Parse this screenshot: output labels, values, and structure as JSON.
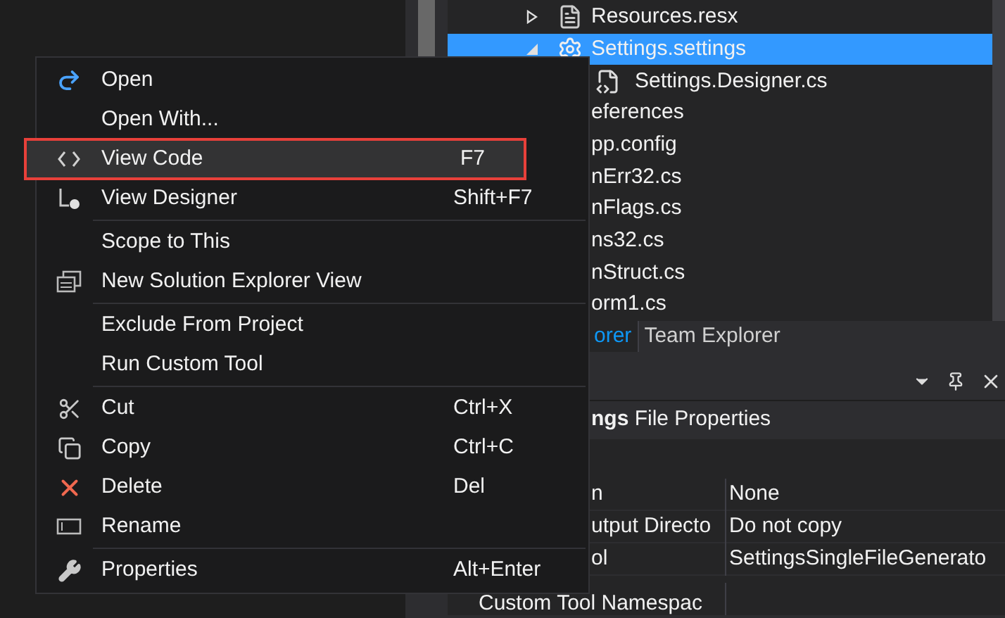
{
  "solution_explorer": {
    "tree": [
      {
        "label": "Resources.resx",
        "expanded": false,
        "selected": false
      },
      {
        "label": "Settings.settings",
        "expanded": true,
        "selected": true,
        "children": [
          {
            "label": "Settings.Designer.cs",
            "selected": false
          }
        ]
      }
    ],
    "covered_items": [
      {
        "label": "eferences"
      },
      {
        "label": "pp.config"
      },
      {
        "label": "nErr32.cs"
      },
      {
        "label": "nFlags.cs"
      },
      {
        "label": "ns32.cs"
      },
      {
        "label": "nStruct.cs"
      },
      {
        "label": "orm1.cs"
      }
    ]
  },
  "panel_tabs": [
    {
      "label": "orer",
      "selected": true
    },
    {
      "label": "Team Explorer",
      "selected": false
    }
  ],
  "properties": {
    "title": "**ngs** File Properties",
    "rows": [
      {
        "name": "n",
        "value": "None"
      },
      {
        "name": "utput Directo",
        "value": "Do not copy"
      },
      {
        "name": "ol",
        "value": "SettingsSingleFileGenerato"
      },
      {
        "name": "Custom Tool Namespac",
        "value": ""
      }
    ]
  },
  "context_menu": {
    "groups": [
      [
        {
          "label": "Open",
          "selected": false,
          "outlined": false
        },
        {
          "label": "Open With...",
          "selected": false,
          "outlined": false
        },
        {
          "label": "View Code",
          "shortcut": "F7",
          "selected": true,
          "outlined": true
        },
        {
          "label": "View Designer",
          "shortcut": "Shift+F7",
          "selected": false,
          "outlined": false
        }
      ],
      [
        {
          "label": "Scope to This",
          "selected": false,
          "outlined": false
        },
        {
          "label": "New Solution Explorer View",
          "selected": false,
          "outlined": false
        }
      ],
      [
        {
          "label": "Exclude From Project",
          "selected": false,
          "outlined": false
        },
        {
          "label": "Run Custom Tool",
          "selected": false,
          "outlined": false
        }
      ],
      [
        {
          "label": "Cut",
          "shortcut": "Ctrl+X",
          "selected": false,
          "outlined": false
        },
        {
          "label": "Copy",
          "shortcut": "Ctrl+C",
          "selected": false,
          "outlined": false
        },
        {
          "label": "Delete",
          "shortcut": "Del",
          "selected": false,
          "outlined": false
        },
        {
          "label": "Rename",
          "selected": false,
          "outlined": false
        }
      ],
      [
        {
          "label": "Properties",
          "shortcut": "Alt+Enter",
          "selected": false,
          "outlined": false
        }
      ]
    ]
  }
}
